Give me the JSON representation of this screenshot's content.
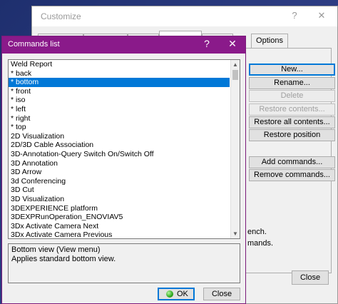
{
  "customize": {
    "title": "Customize",
    "help_label": "?",
    "close_glyph": "✕",
    "tabs": [
      "",
      "",
      "",
      "",
      "Options"
    ],
    "buttons": {
      "new": "New...",
      "rename": "Rename...",
      "delete": "Delete",
      "restore_contents": "Restore contents...",
      "restore_all_contents": "Restore all contents...",
      "restore_position": "Restore position",
      "add_commands": "Add commands...",
      "remove_commands": "Remove commands..."
    },
    "partial_text_1": "ench.",
    "partial_text_2": "mands.",
    "close_label": "Close"
  },
  "commands_list": {
    "title": "Commands list",
    "help_label": "?",
    "close_glyph": "✕",
    "items": [
      "Weld Report",
      "* back",
      "* bottom",
      "* front",
      "* iso",
      "* left",
      "* right",
      "* top",
      "2D Visualization",
      "2D/3D Cable Association",
      "3D-Annotation-Query Switch On/Switch Off",
      "3D Annotation",
      "3D Arrow",
      "3d Conferencing",
      "3D Cut",
      "3D Visualization",
      "3DEXPERIENCE platform",
      "3DEXPRunOperation_ENOVIAV5",
      "3Dx Activate Camera Next",
      "3Dx Activate Camera Previous"
    ],
    "selected_item": "* bottom",
    "description": {
      "line1": "Bottom view (View menu)",
      "line2": "Applies standard bottom view."
    },
    "ok_label": "OK",
    "close_label": "Close"
  },
  "scroll_icons": {
    "up": "scroll-up-icon",
    "down": "scroll-down-icon"
  },
  "colors": {
    "accent": "#8a1a8a",
    "selection": "#0078d7"
  }
}
